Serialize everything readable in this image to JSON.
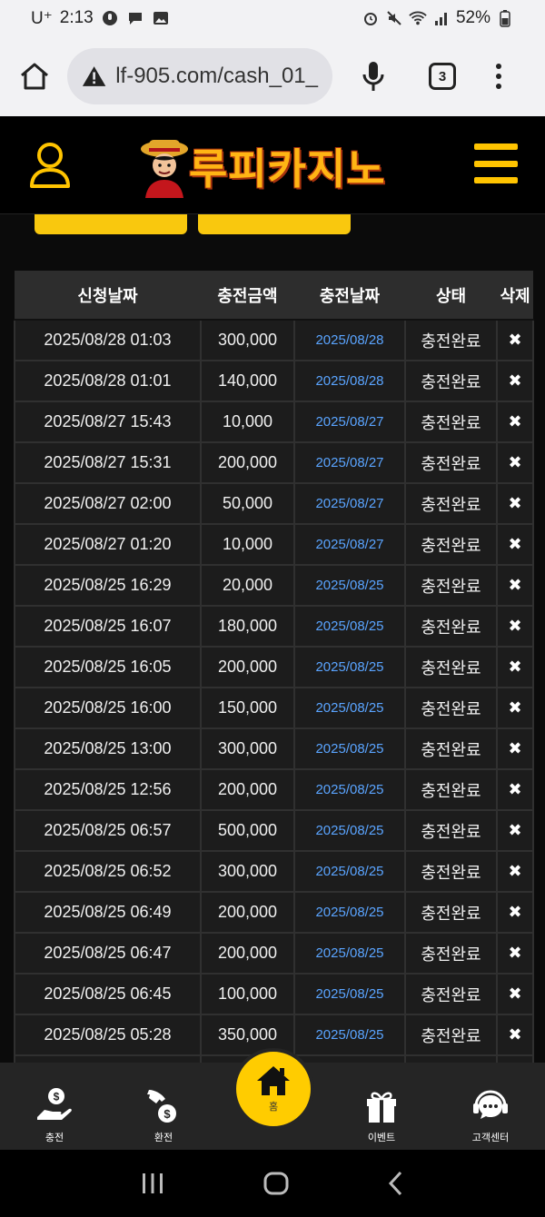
{
  "status_bar": {
    "carrier": "U⁺",
    "time": "2:13",
    "battery": "52%"
  },
  "browser": {
    "url": "lf-905.com/cash_01_",
    "tab_count": "3"
  },
  "header": {
    "logo_text": "루피카지노"
  },
  "table": {
    "headers": [
      "신청날짜",
      "충전금액",
      "충전날짜",
      "상태",
      "삭제"
    ],
    "rows": [
      {
        "requested": "2025/08/28 01:03",
        "amount": "300,000",
        "charged": "2025/08/28",
        "status": "충전완료",
        "delete": "✖"
      },
      {
        "requested": "2025/08/28 01:01",
        "amount": "140,000",
        "charged": "2025/08/28",
        "status": "충전완료",
        "delete": "✖"
      },
      {
        "requested": "2025/08/27 15:43",
        "amount": "10,000",
        "charged": "2025/08/27",
        "status": "충전완료",
        "delete": "✖"
      },
      {
        "requested": "2025/08/27 15:31",
        "amount": "200,000",
        "charged": "2025/08/27",
        "status": "충전완료",
        "delete": "✖"
      },
      {
        "requested": "2025/08/27 02:00",
        "amount": "50,000",
        "charged": "2025/08/27",
        "status": "충전완료",
        "delete": "✖"
      },
      {
        "requested": "2025/08/27 01:20",
        "amount": "10,000",
        "charged": "2025/08/27",
        "status": "충전완료",
        "delete": "✖"
      },
      {
        "requested": "2025/08/25 16:29",
        "amount": "20,000",
        "charged": "2025/08/25",
        "status": "충전완료",
        "delete": "✖"
      },
      {
        "requested": "2025/08/25 16:07",
        "amount": "180,000",
        "charged": "2025/08/25",
        "status": "충전완료",
        "delete": "✖"
      },
      {
        "requested": "2025/08/25 16:05",
        "amount": "200,000",
        "charged": "2025/08/25",
        "status": "충전완료",
        "delete": "✖"
      },
      {
        "requested": "2025/08/25 16:00",
        "amount": "150,000",
        "charged": "2025/08/25",
        "status": "충전완료",
        "delete": "✖"
      },
      {
        "requested": "2025/08/25 13:00",
        "amount": "300,000",
        "charged": "2025/08/25",
        "status": "충전완료",
        "delete": "✖"
      },
      {
        "requested": "2025/08/25 12:56",
        "amount": "200,000",
        "charged": "2025/08/25",
        "status": "충전완료",
        "delete": "✖"
      },
      {
        "requested": "2025/08/25 06:57",
        "amount": "500,000",
        "charged": "2025/08/25",
        "status": "충전완료",
        "delete": "✖"
      },
      {
        "requested": "2025/08/25 06:52",
        "amount": "300,000",
        "charged": "2025/08/25",
        "status": "충전완료",
        "delete": "✖"
      },
      {
        "requested": "2025/08/25 06:49",
        "amount": "200,000",
        "charged": "2025/08/25",
        "status": "충전완료",
        "delete": "✖"
      },
      {
        "requested": "2025/08/25 06:47",
        "amount": "200,000",
        "charged": "2025/08/25",
        "status": "충전완료",
        "delete": "✖"
      },
      {
        "requested": "2025/08/25 06:45",
        "amount": "100,000",
        "charged": "2025/08/25",
        "status": "충전완료",
        "delete": "✖"
      },
      {
        "requested": "2025/08/25 05:28",
        "amount": "350,000",
        "charged": "2025/08/25",
        "status": "충전완료",
        "delete": "✖"
      },
      {
        "requested": "",
        "amount": "",
        "charged": "",
        "status": "",
        "delete": ""
      }
    ]
  },
  "bottom_nav": {
    "items": [
      {
        "label": "충전",
        "icon": "deposit-icon"
      },
      {
        "label": "환전",
        "icon": "withdraw-icon"
      },
      {
        "label": "홈",
        "icon": "home-icon"
      },
      {
        "label": "이벤트",
        "icon": "gift-icon"
      },
      {
        "label": "고객센터",
        "icon": "support-chat-icon"
      }
    ]
  },
  "colors": {
    "accent": "#ffc400",
    "date_link": "#5aa4ff",
    "background": "#0b0b0b"
  }
}
